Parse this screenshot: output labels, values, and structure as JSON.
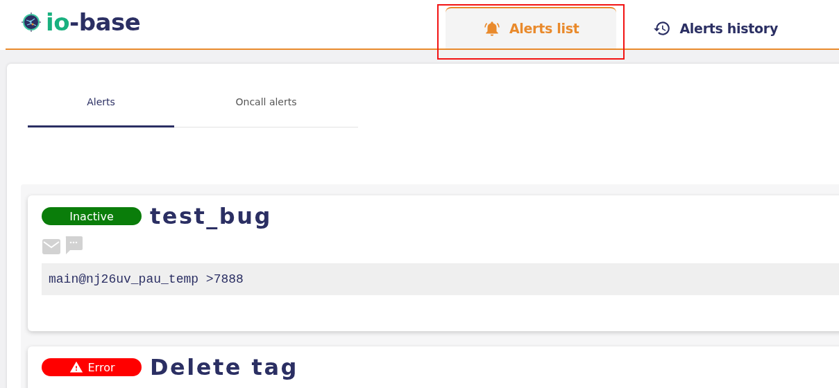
{
  "logo": {
    "accent": "io",
    "rest": "-base"
  },
  "nav_tabs": [
    {
      "label": "Alerts list",
      "kind": "alerts",
      "selected": true,
      "highlighted": true
    },
    {
      "label": "Alerts history",
      "kind": "history",
      "selected": false,
      "highlighted": false
    }
  ],
  "sub_tabs": [
    {
      "label": "Alerts",
      "selected": true
    },
    {
      "label": "Oncall alerts",
      "selected": false
    }
  ],
  "alerts": [
    {
      "kind": "inactive",
      "status": "Inactive",
      "title": "test_bug",
      "notifications": [
        {
          "kind": "email",
          "enabled": false
        },
        {
          "kind": "chat",
          "enabled": false
        }
      ],
      "condition": "main@nj26uv_pau_temp >7888"
    },
    {
      "kind": "error",
      "status": "Error",
      "title": "Delete tag"
    }
  ]
}
